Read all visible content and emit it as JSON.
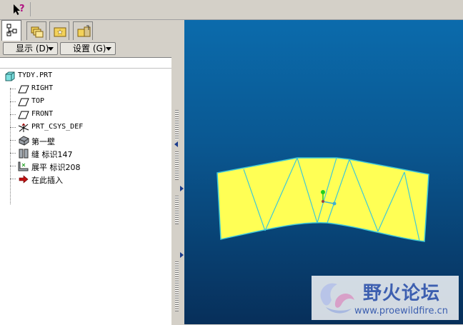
{
  "toolbar": {
    "help_icon": "whats-this-icon"
  },
  "tabs": [
    {
      "name": "model-tree",
      "icon": "model-tree-icon",
      "active": true
    },
    {
      "name": "folder-browser",
      "icon": "folder-icon",
      "active": false
    },
    {
      "name": "favorites",
      "icon": "favorites-icon",
      "active": false
    },
    {
      "name": "connections",
      "icon": "connections-icon",
      "active": false
    }
  ],
  "buttons": {
    "display": "显示 (D)",
    "settings": "设置 (G)"
  },
  "tree": {
    "root": "TYDY.PRT",
    "items": [
      {
        "label": "RIGHT",
        "icon": "datum-plane-icon"
      },
      {
        "label": "TOP",
        "icon": "datum-plane-icon"
      },
      {
        "label": "FRONT",
        "icon": "datum-plane-icon"
      },
      {
        "label": "PRT_CSYS_DEF",
        "icon": "coordinate-system-icon"
      },
      {
        "label": "第一壁",
        "icon": "first-wall-icon"
      },
      {
        "label": "缝 标识147",
        "icon": "rip-icon"
      },
      {
        "label": "展平 标识208",
        "icon": "unbend-icon"
      },
      {
        "label": "在此插入",
        "icon": "insert-here-arrow-icon"
      }
    ]
  },
  "colors": {
    "viewport_top": "#0b6bac",
    "viewport_bottom": "#072f5a",
    "part_fill": "#ffff55",
    "part_edge": "#3ec8d8"
  },
  "watermark": {
    "title": "野火论坛",
    "url": "www.proewildfire.cn"
  }
}
